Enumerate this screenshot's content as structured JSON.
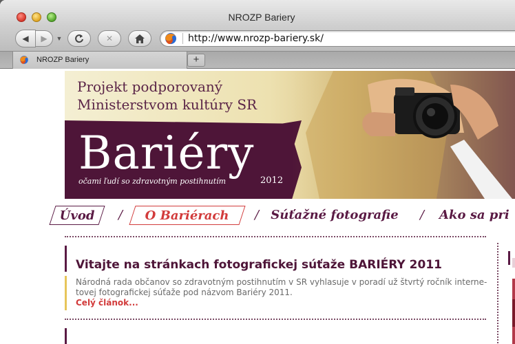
{
  "window": {
    "title": "NROZP Bariery"
  },
  "navigation": {
    "url": "http://www.nrozp-bariery.sk/"
  },
  "tabs": [
    {
      "label": "NROZP Bariery",
      "active": true
    }
  ],
  "header": {
    "tagline_line1": "Projekt podporovaný",
    "tagline_line2": "Ministerstvom kultúry SR",
    "logo_word": "Bariéry",
    "logo_subtitle": "očami ľudí so zdravotným postihnutím",
    "logo_year": "2012"
  },
  "menu": {
    "items": [
      {
        "label": "Úvod",
        "boxed": true,
        "active": false
      },
      {
        "label": "O Bariérach",
        "boxed": true,
        "active": true
      },
      {
        "label": "Súťažné fotografie",
        "boxed": false,
        "active": false
      },
      {
        "label": "Ako sa pri",
        "boxed": false,
        "active": false
      }
    ],
    "separator": "/"
  },
  "article": {
    "title": "Vitajte na stránkach fotografickej súťaže BARIÉRY 2011",
    "body": "Národná rada občanov so zdravotným postihnutím v SR vyhlasuje v poradí už štvrtý ročník interne-tovej fotografickej súťaže pod názvom Bariéry 2011.",
    "more_link": "Celý článok..."
  },
  "colors": {
    "brand_purple": "#4e1538",
    "accent_red": "#d23b3b",
    "accent_yellow": "#e7c55a"
  }
}
